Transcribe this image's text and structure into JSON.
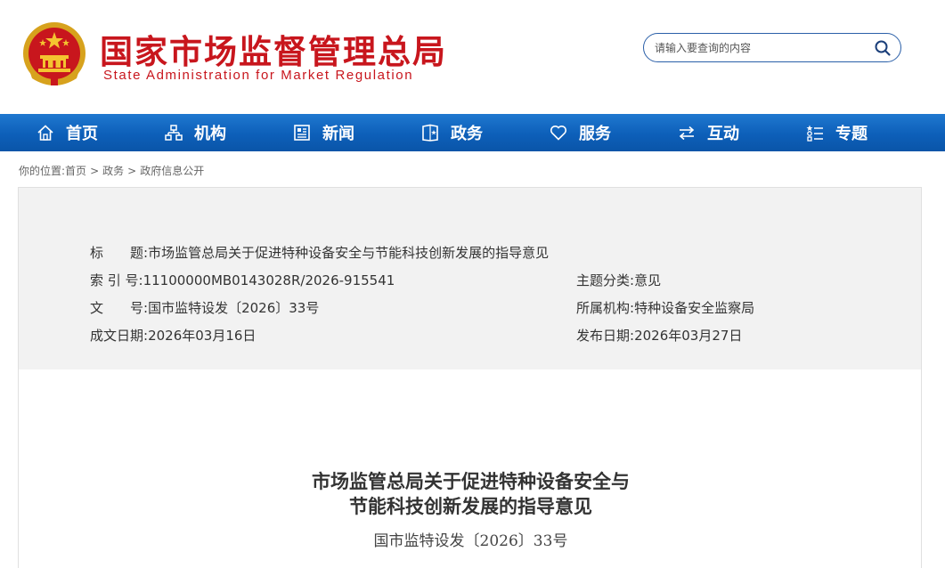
{
  "header": {
    "title": "国家市场监督管理总局",
    "subtitle": "State Administration for Market Regulation",
    "search_placeholder": "请输入要查询的内容",
    "brand_color": "#c8161d"
  },
  "nav": {
    "items": [
      {
        "label": "首页",
        "icon": "home-icon"
      },
      {
        "label": "机构",
        "icon": "org-chart-icon"
      },
      {
        "label": "新闻",
        "icon": "news-icon"
      },
      {
        "label": "政务",
        "icon": "government-affairs-icon"
      },
      {
        "label": "服务",
        "icon": "heart-icon"
      },
      {
        "label": "互动",
        "icon": "exchange-arrows-icon"
      },
      {
        "label": "专题",
        "icon": "topic-list-icon"
      }
    ],
    "color": "#0d5fb9"
  },
  "breadcrumb": {
    "prefix": "你的位置:",
    "items": [
      "首页",
      "政务",
      "政府信息公开"
    ],
    "separator": ">"
  },
  "meta": {
    "title_label": "标　　题:",
    "title_value": "市场监管总局关于促进特种设备安全与节能科技创新发展的指导意见",
    "index_label": "索 引 号:",
    "index_value": "11100000MB0143028R/2026-915541",
    "topic_label": "主题分类:",
    "topic_value": "意见",
    "doc_no_label": "文　　号:",
    "doc_no_value": "国市监特设发〔2026〕33号",
    "agency_label": "所属机构:",
    "agency_value": "特种设备安全监察局",
    "written_label": "成文日期:",
    "written_value": "2026年03月16日",
    "published_label": "发布日期:",
    "published_value": "2026年03月27日"
  },
  "document": {
    "title_line1": "市场监管总局关于促进特种设备安全与",
    "title_line2": "节能科技创新发展的指导意见",
    "number": "国市监特设发〔2026〕33号"
  }
}
